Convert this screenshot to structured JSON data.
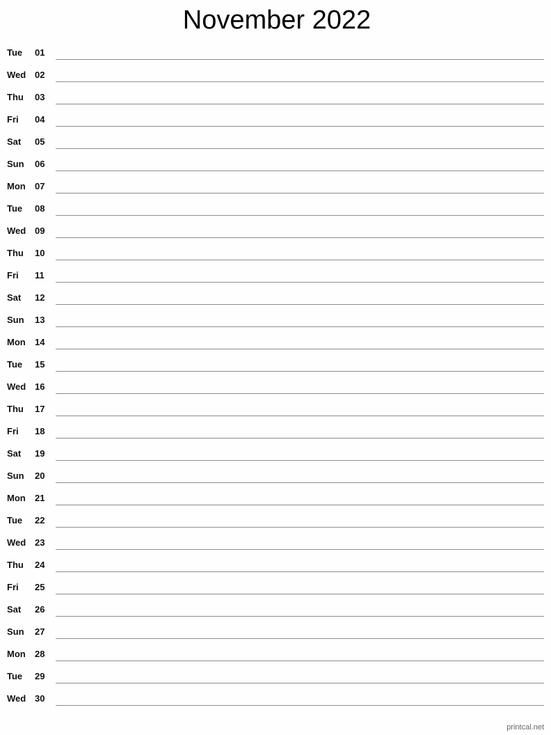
{
  "title": "November 2022",
  "days": [
    {
      "day": "Tue",
      "date": "01"
    },
    {
      "day": "Wed",
      "date": "02"
    },
    {
      "day": "Thu",
      "date": "03"
    },
    {
      "day": "Fri",
      "date": "04"
    },
    {
      "day": "Sat",
      "date": "05"
    },
    {
      "day": "Sun",
      "date": "06"
    },
    {
      "day": "Mon",
      "date": "07"
    },
    {
      "day": "Tue",
      "date": "08"
    },
    {
      "day": "Wed",
      "date": "09"
    },
    {
      "day": "Thu",
      "date": "10"
    },
    {
      "day": "Fri",
      "date": "11"
    },
    {
      "day": "Sat",
      "date": "12"
    },
    {
      "day": "Sun",
      "date": "13"
    },
    {
      "day": "Mon",
      "date": "14"
    },
    {
      "day": "Tue",
      "date": "15"
    },
    {
      "day": "Wed",
      "date": "16"
    },
    {
      "day": "Thu",
      "date": "17"
    },
    {
      "day": "Fri",
      "date": "18"
    },
    {
      "day": "Sat",
      "date": "19"
    },
    {
      "day": "Sun",
      "date": "20"
    },
    {
      "day": "Mon",
      "date": "21"
    },
    {
      "day": "Tue",
      "date": "22"
    },
    {
      "day": "Wed",
      "date": "23"
    },
    {
      "day": "Thu",
      "date": "24"
    },
    {
      "day": "Fri",
      "date": "25"
    },
    {
      "day": "Sat",
      "date": "26"
    },
    {
      "day": "Sun",
      "date": "27"
    },
    {
      "day": "Mon",
      "date": "28"
    },
    {
      "day": "Tue",
      "date": "29"
    },
    {
      "day": "Wed",
      "date": "30"
    }
  ],
  "footer": "printcal.net"
}
